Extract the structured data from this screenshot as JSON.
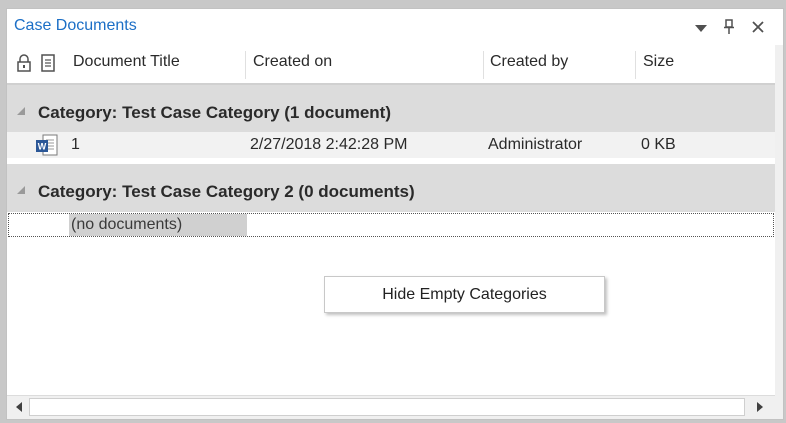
{
  "window": {
    "title": "Case Documents",
    "icons": [
      "dropdown-arrow-icon",
      "pin-icon",
      "close-icon"
    ]
  },
  "columns": {
    "lock_icon": "lock-icon",
    "doc_icon": "document-icon",
    "title": "Document Title",
    "created_on": "Created on",
    "created_by": "Created by",
    "size": "Size"
  },
  "categories": [
    {
      "label": "Category: Test Case Category (1 document)",
      "rows": [
        {
          "icon": "word-document-icon",
          "title": "1",
          "created_on": "2/27/2018 2:42:28 PM",
          "created_by": "Administrator",
          "size": "0 KB"
        }
      ]
    },
    {
      "label": "Category: Test Case Category 2 (0 documents)",
      "empty_text": "(no documents)"
    }
  ],
  "context_menu": {
    "hide_empty_label": "Hide Empty Categories"
  },
  "colors": {
    "title": "#1c6fc6",
    "category_bg": "#dcdcdc",
    "row_bg": "#f2f2f2"
  }
}
